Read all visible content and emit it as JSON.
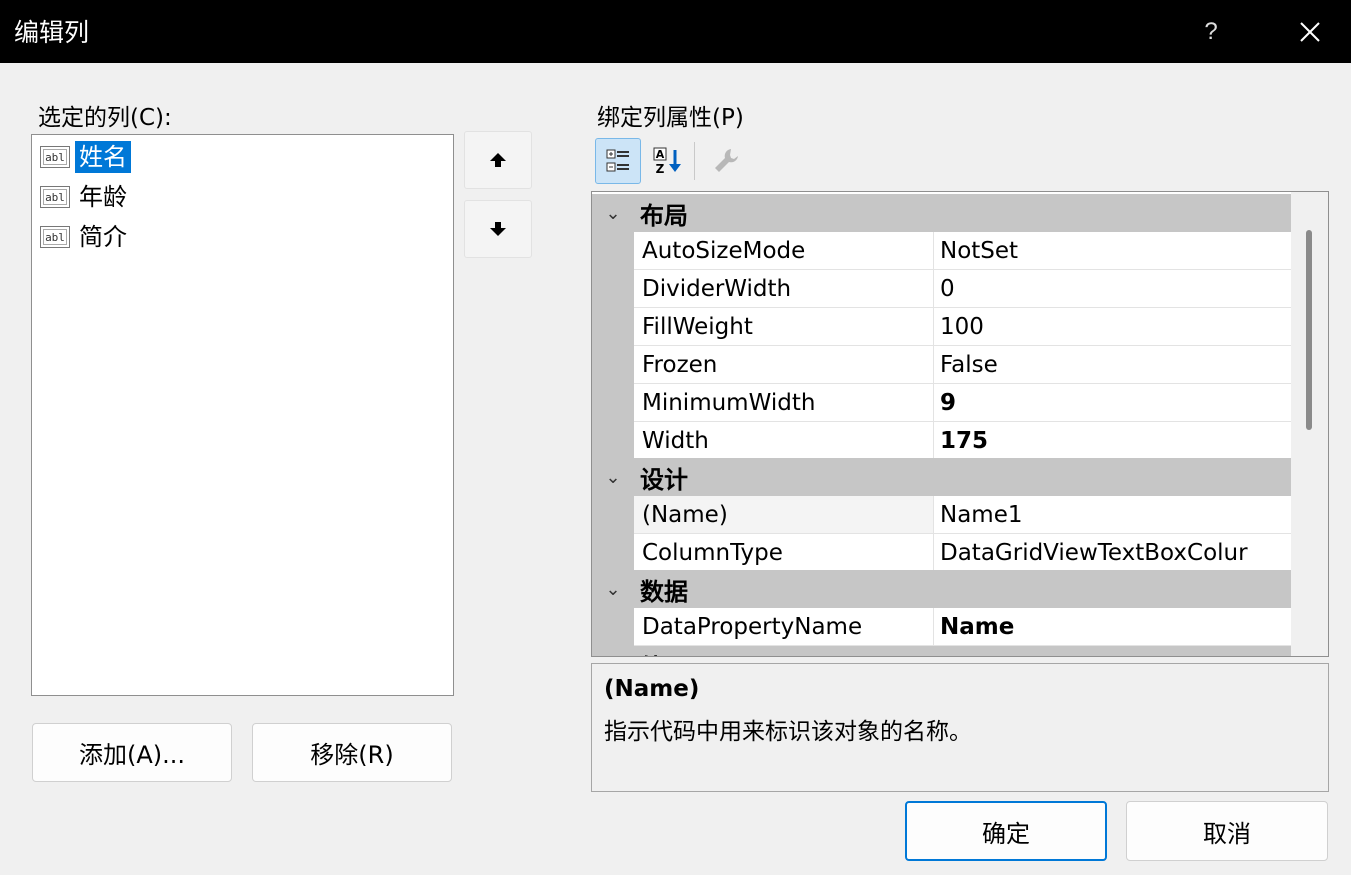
{
  "window": {
    "title": "编辑列",
    "help_label": "?",
    "close_icon": "close-icon"
  },
  "left": {
    "selected_columns_label": "选定的列(C):",
    "columns": [
      {
        "icon": "abl",
        "label": "姓名",
        "selected": true
      },
      {
        "icon": "abl",
        "label": "年龄",
        "selected": false
      },
      {
        "icon": "abl",
        "label": "简介",
        "selected": false
      }
    ],
    "move_up_icon": "arrow-up-icon",
    "move_down_icon": "arrow-down-icon",
    "add_label": "添加(A)...",
    "remove_label": "移除(R)"
  },
  "right": {
    "properties_label": "绑定列属性(P)",
    "toolbar": {
      "categorized_icon": "categorized-icon",
      "alphabetical_icon": "alphabetical-sort-icon",
      "property_pages_icon": "wrench-icon"
    },
    "categories": [
      {
        "name": "布局",
        "properties": [
          {
            "name": "AutoSizeMode",
            "value": "NotSet",
            "bold": false
          },
          {
            "name": "DividerWidth",
            "value": "0",
            "bold": false
          },
          {
            "name": "FillWeight",
            "value": "100",
            "bold": false
          },
          {
            "name": "Frozen",
            "value": "False",
            "bold": false
          },
          {
            "name": "MinimumWidth",
            "value": "9",
            "bold": true
          },
          {
            "name": "Width",
            "value": "175",
            "bold": true
          }
        ]
      },
      {
        "name": "设计",
        "properties": [
          {
            "name": "(Name)",
            "value": "Name1",
            "bold": false
          },
          {
            "name": "ColumnType",
            "value": "DataGridViewTextBoxColur",
            "bold": false
          }
        ]
      },
      {
        "name": "数据",
        "properties": [
          {
            "name": "DataPropertyName",
            "value": "Name",
            "bold": true
          }
        ]
      },
      {
        "name": "外观",
        "properties": []
      }
    ],
    "description": {
      "title": "(Name)",
      "text": "指示代码中用来标识该对象的名称。"
    }
  },
  "footer": {
    "ok_label": "确定",
    "cancel_label": "取消"
  },
  "colors": {
    "accent": "#0078d7",
    "titlebar": "#000000",
    "category_bg": "#c6c6c6"
  }
}
